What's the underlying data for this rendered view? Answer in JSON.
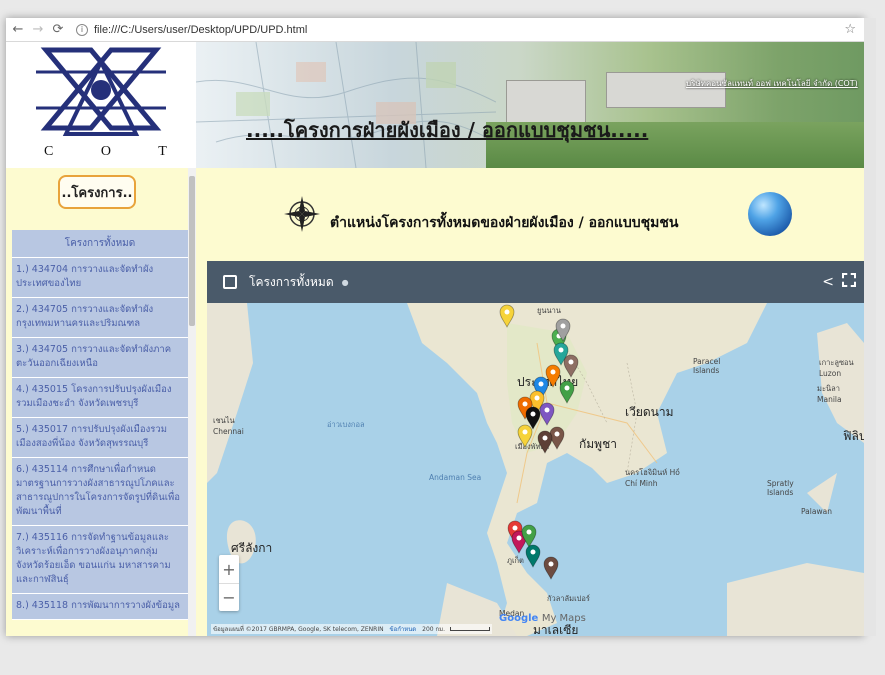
{
  "browser": {
    "url": "file:///C:/Users/user/Desktop/UPD/UPD.html"
  },
  "banner": {
    "logo_text": "C O T",
    "title": ".....โครงการฝ่ายผังเมือง / ออกแบบชุมชน.....",
    "company": "บริษัทคอนซัลแทนท์ ออฟ เทคโนโลยี จำกัด (COT)"
  },
  "sidebar": {
    "menu_button": "..โครงการ..",
    "list_header": "โครงการทั้งหมด",
    "items": [
      "1.) 434704 การวางและจัดทำผังประเทศของไทย",
      "2.) 434705 การวางและจัดทำผังกรุงเทพมหานครและปริมณฑล",
      "3.) 434705 การวางและจัดทำผังภาคตะวันออกเฉียงเหนือ",
      "4.) 435015 โครงการปรับปรุงผังเมืองรวมเมืองชะอำ จังหวัดเพชรบุรี",
      "5.) 435017 การปรับปรุงผังเมืองรวมเมืองสองพี่น้อง จังหวัดสุพรรณบุรี",
      "6.) 435114 การศึกษาเพื่อกำหนดมาตรฐานการวางผังสาธารณูปโภคและสาธารณูปการในโครงการจัดรูปที่ดินเพื่อพัฒนาพื้นที่",
      "7.) 435116 การจัดทำฐานข้อมูลและวิเคราะห์เพื่อการวางผังอนุภาคกลุ่มจังหวัดร้อยเอ็ด ขอนแก่น มหาสารคาม และกาฬสินธุ์",
      "8.) 435118 การพัฒนาการวางผังข้อมูล"
    ]
  },
  "main": {
    "heading": "ตำแหน่งโครงการทั้งหมดของฝ่ายผังเมือง / ออกแบบชุมชน",
    "map": {
      "title": "โครงการทั้งหมด",
      "labels": [
        {
          "text": "ยูนนาน"
        },
        {
          "text": "Paracel Islands"
        },
        {
          "text": "เกาะลูซอน Luzon"
        },
        {
          "text": "มะนิลา Manila"
        },
        {
          "text": "ประเทศไทย"
        },
        {
          "text": "เวียดนาม"
        },
        {
          "text": "กัมพูชา"
        },
        {
          "text": "ฟิลิปปินส์"
        },
        {
          "text": "เมืองพัทยา"
        },
        {
          "text": "เชนไน Chennai"
        },
        {
          "text": "Andaman Sea"
        },
        {
          "text": "นครโฮจิมินห์ Hồ Chí Minh"
        },
        {
          "text": "ศรีลังกา"
        },
        {
          "text": "Spratly Islands"
        },
        {
          "text": "Palawan"
        },
        {
          "text": "มาเลเซีย"
        },
        {
          "text": "Medan"
        },
        {
          "text": "กัวลาลัมเปอร์"
        },
        {
          "text": "ภูเก็ต"
        },
        {
          "text": "อ่าวเบงกอล"
        }
      ],
      "markers": [
        {
          "color": "#f6d33a"
        },
        {
          "color": "#4caf50"
        },
        {
          "color": "#8d6e63"
        },
        {
          "color": "#a0a0a0"
        },
        {
          "color": "#26a69a"
        },
        {
          "color": "#f57c00"
        },
        {
          "color": "#43a047"
        },
        {
          "color": "#1e88e5"
        },
        {
          "color": "#fbc02d"
        },
        {
          "color": "#ef6c00"
        },
        {
          "color": "#111111"
        },
        {
          "color": "#7e57c2"
        },
        {
          "color": "#f6d33a"
        },
        {
          "color": "#795548"
        },
        {
          "color": "#5d4037"
        },
        {
          "color": "#e53935"
        },
        {
          "color": "#c2185b"
        },
        {
          "color": "#43a047"
        },
        {
          "color": "#00796b"
        },
        {
          "color": "#6d4c41"
        }
      ],
      "attribution": "ข้อมูลแผนที่ ©2017 GBRMPA, Google, SK telecom, ZENRIN",
      "terms": "ข้อกำหนด",
      "scale": "200 กม.",
      "google": "Google",
      "mymaps": "My Maps"
    }
  },
  "colors": {
    "sidebar_bg": "#fdfbd0",
    "list_bg": "#b8c7e2",
    "list_text": "#4a5fa8",
    "map_header": "#4a5a6a",
    "button_border": "#e8a33b"
  }
}
